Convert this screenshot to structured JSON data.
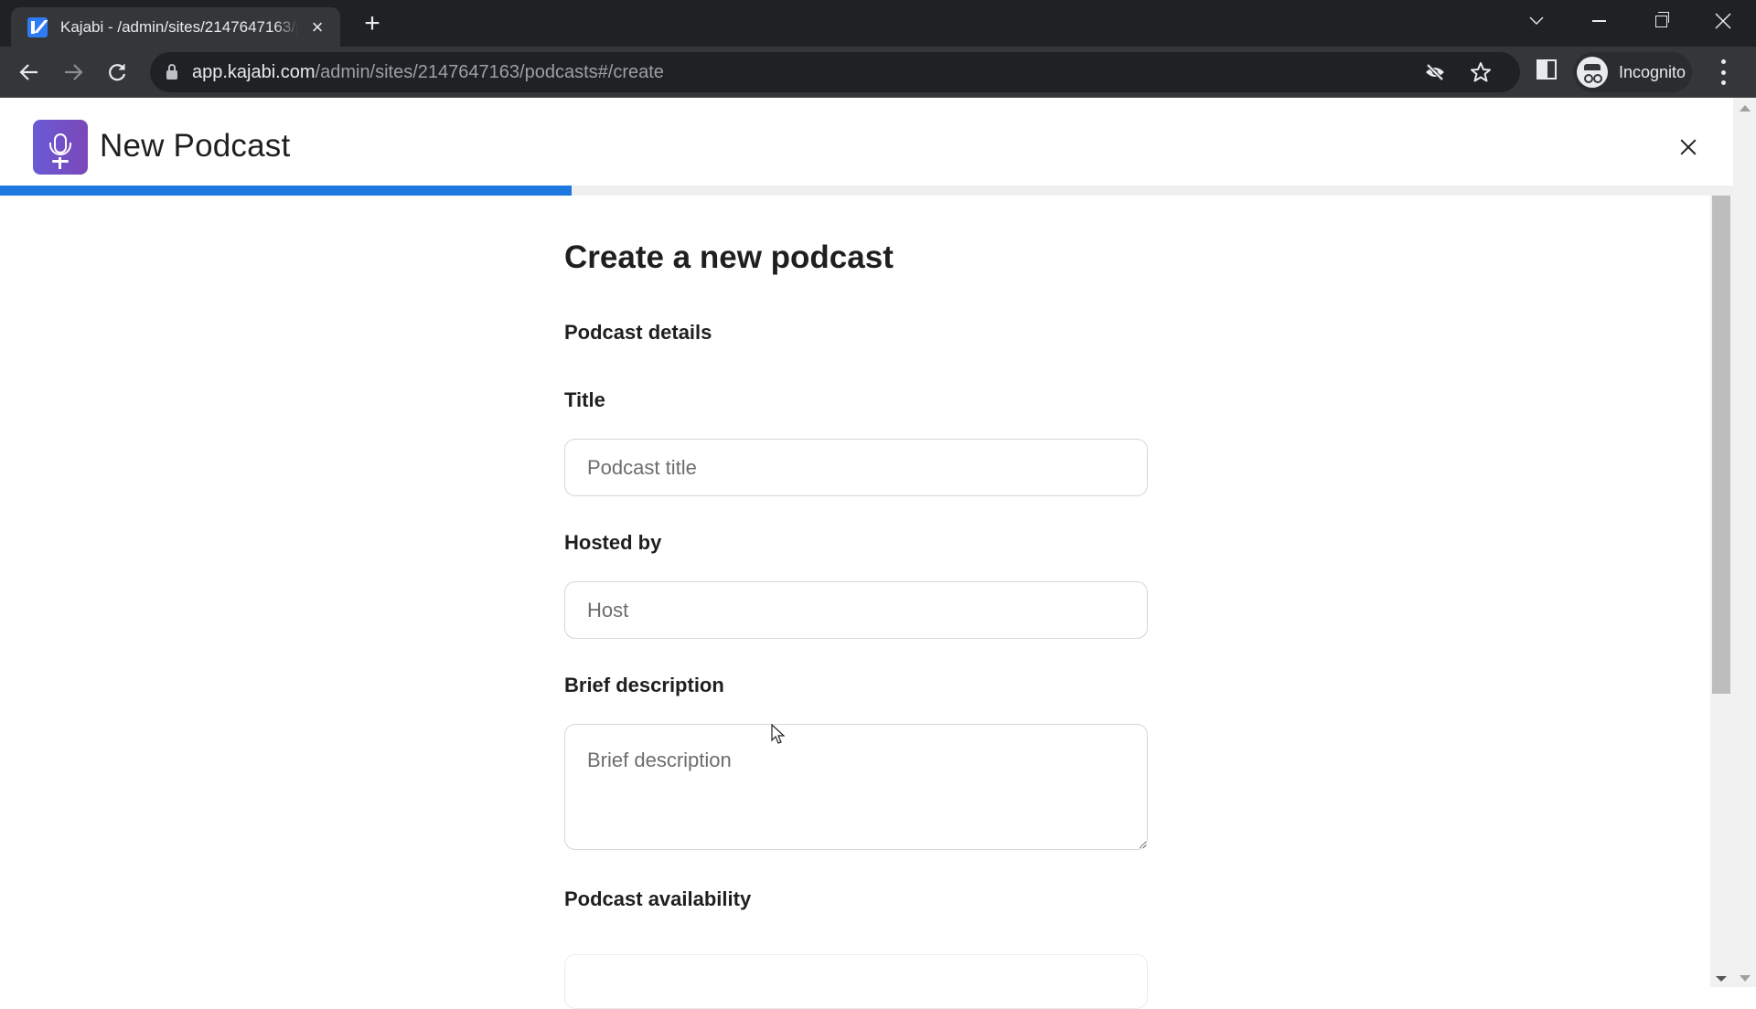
{
  "browser": {
    "tab": {
      "title": "Kajabi - /admin/sites/2147647163/podcasts#/create",
      "favicon": "kajabi-logo-icon"
    },
    "new_tab_label": "+",
    "url": {
      "host": "app.kajabi.com",
      "path": "/admin/sites/2147647163/podcasts#/create"
    },
    "profile_label": "Incognito",
    "icons": {
      "back": "arrow-left-icon",
      "forward": "arrow-right-icon",
      "reload": "reload-icon",
      "lock": "lock-icon",
      "tracking": "eye-slash-icon",
      "bookmark": "star-icon",
      "side_panel": "side-panel-icon",
      "menu": "kebab-menu-icon"
    }
  },
  "modal": {
    "icon": "microphone-icon",
    "icon_gradient": [
      "#6a5ad6",
      "#7b48b8"
    ],
    "title": "New Podcast",
    "progress": {
      "fraction": 0.33,
      "color": "#1e78e0"
    }
  },
  "form": {
    "heading": "Create a new podcast",
    "section_details": "Podcast details",
    "fields": {
      "title": {
        "label": "Title",
        "placeholder": "Podcast title",
        "value": ""
      },
      "host": {
        "label": "Hosted by",
        "placeholder": "Host",
        "value": ""
      },
      "description": {
        "label": "Brief description",
        "placeholder": "Brief description",
        "value": ""
      }
    },
    "section_availability": "Podcast availability"
  }
}
